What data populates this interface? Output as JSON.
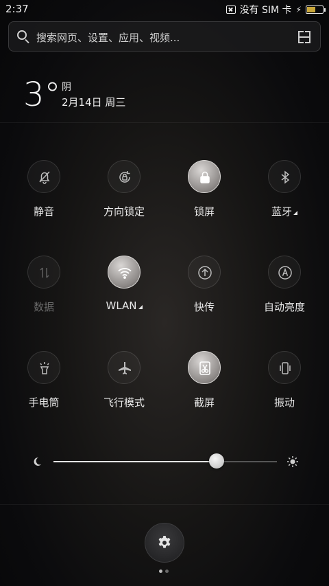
{
  "status_bar": {
    "time": "2:37",
    "sim_text": "没有 SIM 卡",
    "battery_level": 0.55,
    "icons": [
      "no-sim-icon",
      "charging-icon",
      "battery-icon"
    ]
  },
  "search": {
    "placeholder": "搜索网页、设置、应用、视频...",
    "icons": [
      "search-icon",
      "scan-icon"
    ]
  },
  "weather": {
    "temperature": "3°",
    "condition": "阴",
    "date": "2月14日 周三"
  },
  "toggles": [
    {
      "id": "mute",
      "label": "静音",
      "icon": "bell-off-icon",
      "state": "off"
    },
    {
      "id": "rotation-lock",
      "label": "方向锁定",
      "icon": "rotation-lock-icon",
      "state": "off"
    },
    {
      "id": "lock-screen",
      "label": "锁屏",
      "icon": "lock-icon",
      "state": "on"
    },
    {
      "id": "bluetooth",
      "label": "蓝牙",
      "icon": "bluetooth-icon",
      "state": "off",
      "has_more": true
    },
    {
      "id": "data",
      "label": "数据",
      "icon": "data-arrows-icon",
      "state": "disabled"
    },
    {
      "id": "wlan",
      "label": "WLAN",
      "icon": "wifi-icon",
      "state": "on",
      "has_more": true
    },
    {
      "id": "quick-share",
      "label": "快传",
      "icon": "upload-arrow-icon",
      "state": "off"
    },
    {
      "id": "auto-brightness",
      "label": "自动亮度",
      "icon": "auto-brightness-icon",
      "state": "off"
    },
    {
      "id": "flashlight",
      "label": "手电筒",
      "icon": "flashlight-icon",
      "state": "off"
    },
    {
      "id": "airplane",
      "label": "飞行模式",
      "icon": "airplane-icon",
      "state": "off"
    },
    {
      "id": "screenshot",
      "label": "截屏",
      "icon": "scissors-icon",
      "state": "on"
    },
    {
      "id": "vibrate",
      "label": "振动",
      "icon": "vibrate-icon",
      "state": "off"
    }
  ],
  "brightness": {
    "level": 0.73,
    "icons": [
      "moon-icon",
      "sun-icon"
    ]
  },
  "footer": {
    "settings_icon": "gear-icon",
    "page_count": 2,
    "active_page": 1
  }
}
